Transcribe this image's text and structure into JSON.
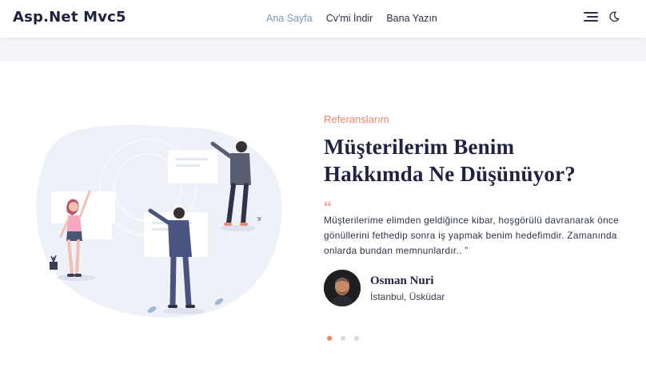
{
  "brand": "Asp.Net Mvc5",
  "nav": {
    "items": [
      {
        "label": "Ana Sayfa",
        "active": true
      },
      {
        "label": "Cv'mi İndir",
        "active": false
      },
      {
        "label": "Bana Yazın",
        "active": false
      }
    ]
  },
  "icons": {
    "menu": "hamburger-icon",
    "theme": "moon-icon"
  },
  "testimonial": {
    "eyebrow": "Referanslarım",
    "heading_line1": "Müşterilerim Benim",
    "heading_line2": "Hakkımda Ne Düşünüyor?",
    "quote_mark": "“",
    "quote": "Müşterilerime elimden geldiğince kibar, hoşgörülü davranarak önce gönüllerini fethedip sonra iş yapmak benim hedefimdir. Zamanında onlarda bundan memnunlardır.. ”",
    "author_name": "Osman Nuri",
    "author_place": "İstanbul, Üsküdar"
  },
  "carousel": {
    "count": 3,
    "active_index": 0
  },
  "colors": {
    "accent": "#f3856a",
    "nav_active": "#7d97b5",
    "text": "#1f2340",
    "band": "#f4f5f9"
  }
}
